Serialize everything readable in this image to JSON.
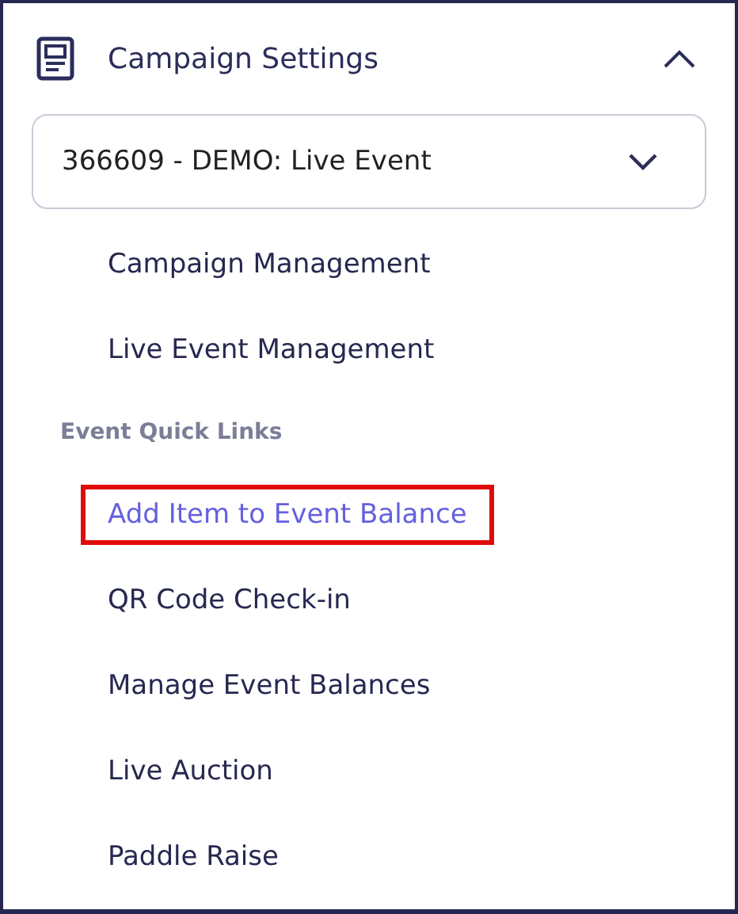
{
  "panel": {
    "title": "Campaign Settings",
    "expanded": true
  },
  "campaign_select": {
    "value": "366609 - DEMO: Live Event"
  },
  "links": [
    {
      "label": "Campaign Management",
      "selected": false,
      "highlighted": false
    },
    {
      "label": "Live Event Management",
      "selected": false,
      "highlighted": false
    }
  ],
  "quick_links": {
    "title": "Event Quick Links",
    "items": [
      {
        "label": "Add Item to Event Balance",
        "selected": true,
        "highlighted": true
      },
      {
        "label": "QR Code Check-in",
        "selected": false,
        "highlighted": false
      },
      {
        "label": "Manage Event Balances",
        "selected": false,
        "highlighted": false
      },
      {
        "label": "Live Auction",
        "selected": false,
        "highlighted": false
      },
      {
        "label": "Paddle Raise",
        "selected": false,
        "highlighted": false
      }
    ]
  }
}
